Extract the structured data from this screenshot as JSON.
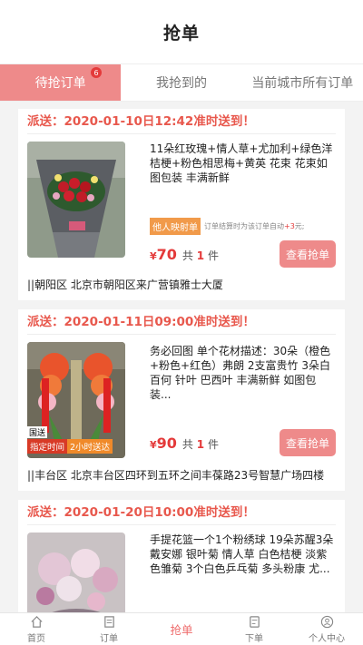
{
  "header": {
    "title": "抢单"
  },
  "tabs": [
    {
      "label": "待抢订单",
      "badge": "6",
      "active": true
    },
    {
      "label": "我抢到的",
      "active": false
    },
    {
      "label": "当前城市所有订单",
      "active": false
    }
  ],
  "orders": [
    {
      "ship": "派送：2020-01-10日12:42准时送到！",
      "desc": "11朵红玫瑰+情人草+尤加利+绿色洋桔梗+粉色相思梅+黄英 花束  花束如图包装 丰满新鲜",
      "tag": "他人映射单",
      "tag_note": "订单结算时为该订单自动",
      "tag_plus": "+3",
      "tag_suffix": "元;",
      "currency": "¥",
      "price": "70",
      "qty_prefix": "共",
      "qty": "1",
      "qty_suffix": "件",
      "button": "查看抢单",
      "address": "||朝阳区  北京市朝阳区来广营镇雅士大厦"
    },
    {
      "ship": "派送：2020-01-11日09:00准时送到！",
      "desc": "务必回图  单个花材描述：30朵（橙色+粉色+红色）弗朗 2支富贵竹 3朵白百何 针叶 巴西叶 丰满新鲜 如图包装...",
      "img_tag_left": "国送",
      "img_badge_1": "指定时间",
      "img_badge_2": "2小时送达",
      "currency": "¥",
      "price": "90",
      "qty_prefix": "共",
      "qty": "1",
      "qty_suffix": "件",
      "button": "查看抢单",
      "address": "||丰台区  北京丰台区四环到五环之间丰葆路23号智慧广场四楼"
    },
    {
      "ship": "派送：2020-01-20日10:00准时送到！",
      "desc": "手提花篮一个1个粉绣球 19朵苏醒3朵 戴安娜 银叶菊 情人草 白色桔梗 淡紫色雏菊 3个白色乒乓菊 多头粉康 尤..."
    }
  ],
  "tabbar": [
    {
      "label": "首页",
      "icon": "home-icon",
      "active": false
    },
    {
      "label": "订单",
      "icon": "order-icon",
      "active": false
    },
    {
      "label": "抢单",
      "icon": "",
      "active": true
    },
    {
      "label": "下单",
      "icon": "place-order-icon",
      "active": false
    },
    {
      "label": "个人中心",
      "icon": "user-icon",
      "active": false
    }
  ],
  "colors": {
    "accent": "#ee8a8a",
    "price": "#e43a3a",
    "ship": "#e8584d",
    "tag": "#f19a4a"
  }
}
